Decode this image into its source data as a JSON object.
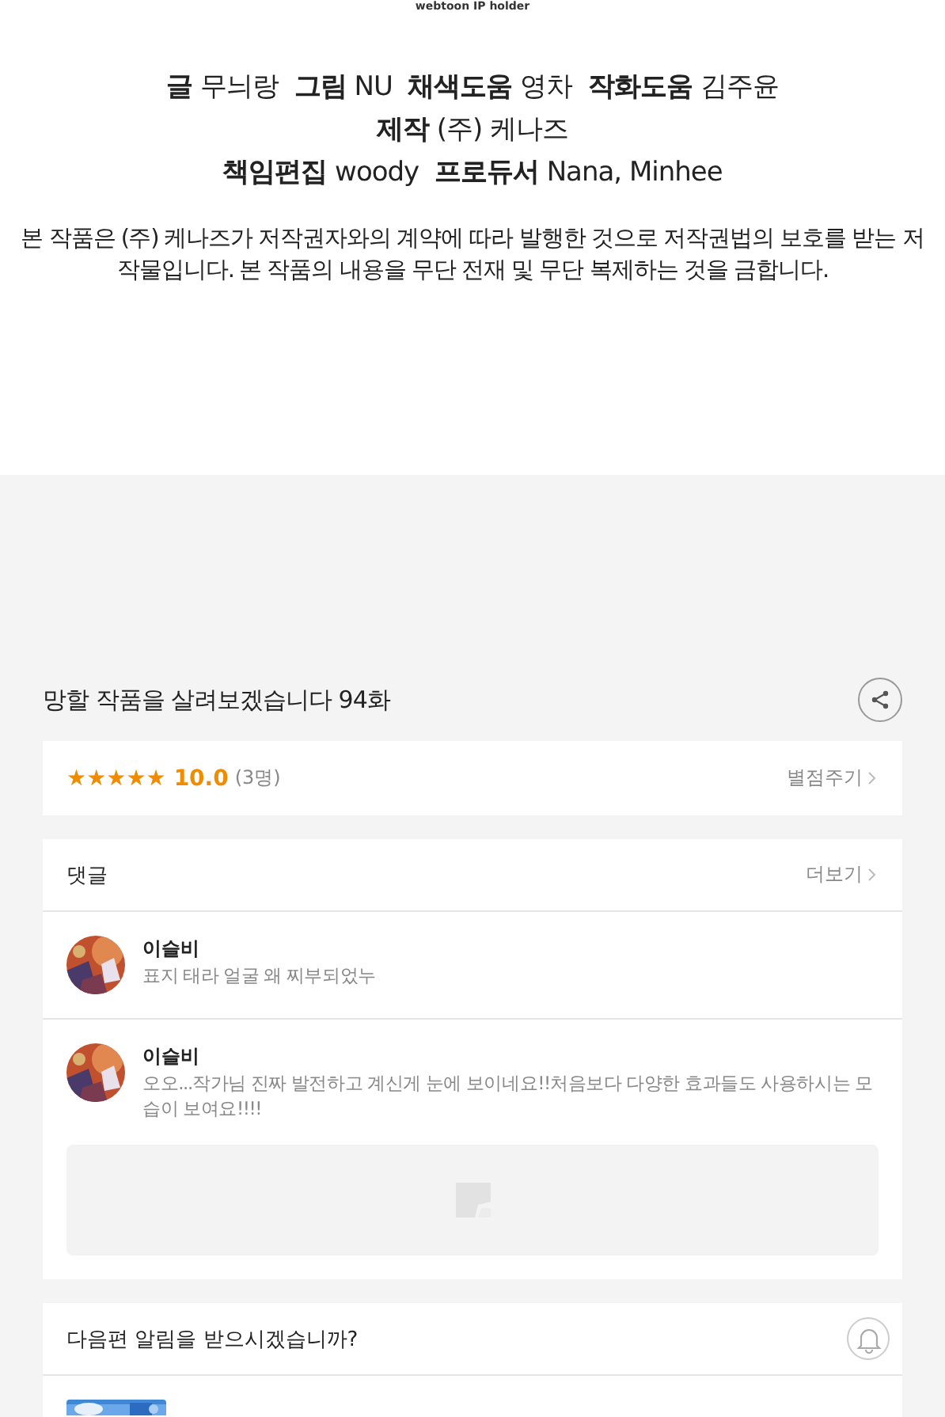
{
  "header": {
    "caption": "webtoon IP holder",
    "credits": [
      "**글** 무늬랑  **그림** NU  **채색도움** 영차  **작화도움** 김주윤",
      "**제작** (주) 케나즈",
      "**책임편집** woody  **프로듀서** Nana, Minhee"
    ],
    "notice": "본 작품은 (주) 케나즈가 저작권자와의 계약에 따라 발행한 것으로 저작권법의 보호를 받는 저작물입니다. 본 작품의 내용을 무단 전재 및 무단 복제하는 것을 금합니다."
  },
  "episode": {
    "title": "망할 작품을 살려보겠습니다 94화"
  },
  "rating": {
    "stars": 5,
    "score": "10.0",
    "count": "(3명)",
    "action": "별점주기"
  },
  "comments": {
    "title": "댓글",
    "more": "더보기",
    "items": [
      {
        "author": "이슬비",
        "text": "표지 태라 얼굴 왜 찌부되었누",
        "attachment": false
      },
      {
        "author": "이슬비",
        "text": "오오...작가님 진짜 발전하고 계신게 눈에 보이네요!!처음보다 다양한 효과들도 사용하시는 모습이 보여요!!!!",
        "attachment": true
      }
    ]
  },
  "subscribe": {
    "question": "다음편 알림을 받으시겠습니까?"
  }
}
